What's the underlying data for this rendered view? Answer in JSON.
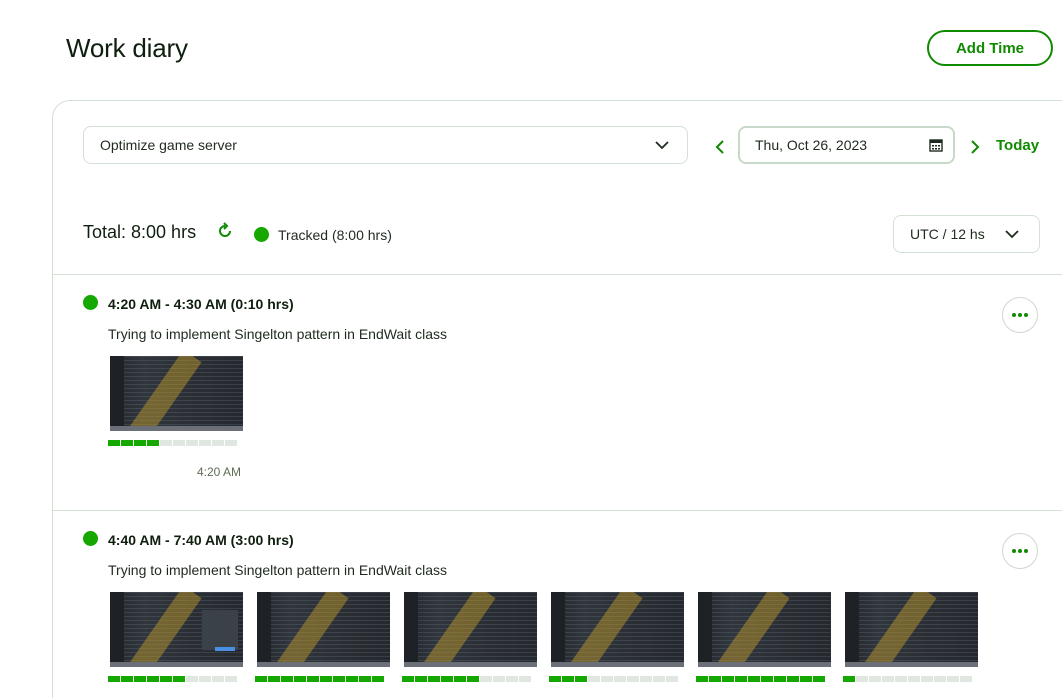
{
  "header": {
    "title": "Work diary",
    "add_time_label": "Add Time"
  },
  "filters": {
    "contract": "Optimize game server",
    "date": "Thu, Oct 26, 2023",
    "today_label": "Today",
    "timezone": "UTC / 12 hs"
  },
  "summary": {
    "total": "Total: 8:00 hrs",
    "tracked_label": "Tracked (8:00 hrs)"
  },
  "segments": [
    {
      "time_range": "4:20 AM - 4:30 AM (0:10 hrs)",
      "memo": "Trying to implement Singelton pattern in EndWait class",
      "screenshots": [
        {
          "time": "4:20 AM",
          "activity_level": 4,
          "activity_max": 10
        }
      ]
    },
    {
      "time_range": "4:40 AM - 7:40 AM (3:00 hrs)",
      "memo": "Trying to implement Singelton pattern in EndWait class",
      "screenshots": [
        {
          "activity_level": 6,
          "activity_max": 10
        },
        {
          "activity_level": 10,
          "activity_max": 10
        },
        {
          "activity_level": 6,
          "activity_max": 10
        },
        {
          "activity_level": 3,
          "activity_max": 10
        },
        {
          "activity_level": 10,
          "activity_max": 10
        },
        {
          "activity_level": 1,
          "activity_max": 10
        }
      ]
    }
  ],
  "colors": {
    "accent": "#108a00",
    "tracked": "#14a800",
    "border": "#d5e0d5",
    "activity_off": "#e0e6e0"
  }
}
